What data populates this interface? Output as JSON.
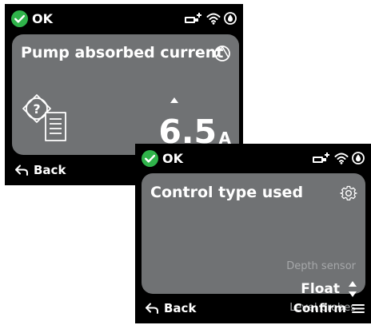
{
  "screens": [
    {
      "status": {
        "label": "OK"
      },
      "card": {
        "title": "Pump absorbed current",
        "value": "6.5",
        "unit": "A"
      },
      "footer": {
        "back_label": "Back"
      }
    },
    {
      "status": {
        "label": "OK"
      },
      "card": {
        "title": "Control type used",
        "options": {
          "previous": "Depth sensor",
          "selected": "Float",
          "next": "Level probes"
        }
      },
      "footer": {
        "back_label": "Back",
        "confirm_label": "Confirm"
      }
    }
  ],
  "colors": {
    "ok_green": "#2fb34a",
    "card_gray": "#707274",
    "background": "#000000",
    "dim_text": "#a6a8aa"
  },
  "icons": [
    "check-circle-icon",
    "usb-plug-icon",
    "wifi-icon",
    "drop-icon",
    "pump-icon",
    "help-document-icon",
    "gear-icon",
    "up-down-icon",
    "back-arrow-icon",
    "menu-icon"
  ]
}
